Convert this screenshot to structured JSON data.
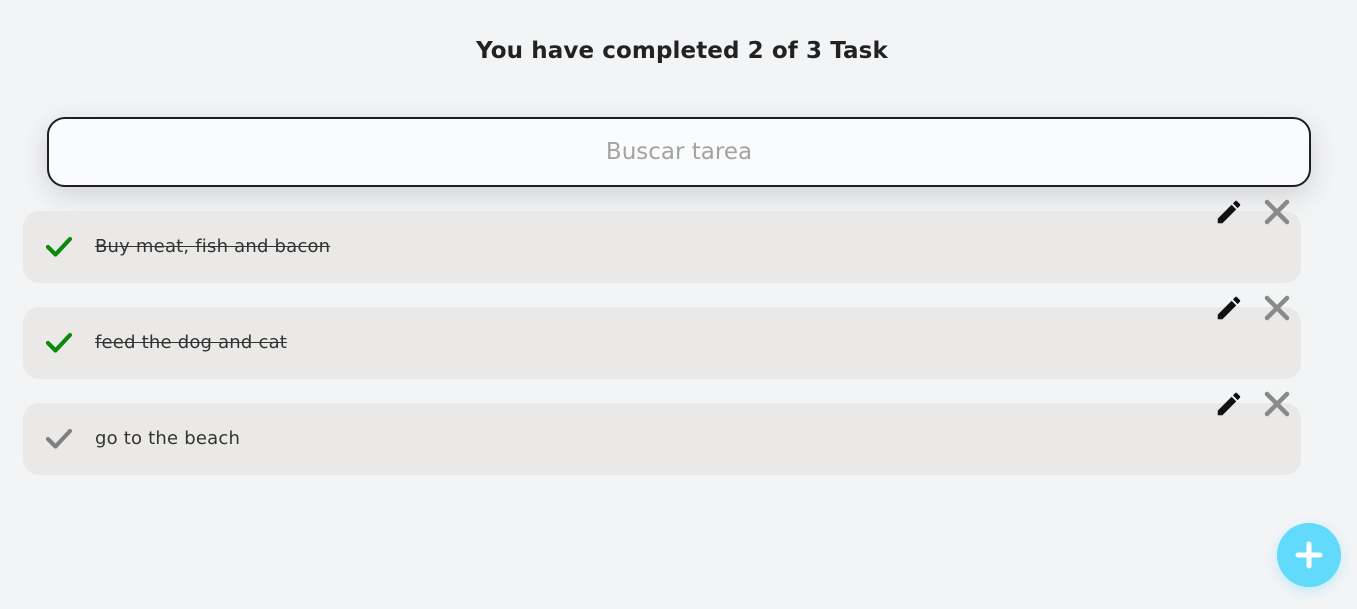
{
  "counter": {
    "prefix": "You have completed",
    "completed": "2",
    "of": "of",
    "total": "3",
    "suffix": "Task"
  },
  "search": {
    "placeholder": "Buscar tarea",
    "value": ""
  },
  "todos": [
    {
      "text": "Buy meat, fish and bacon",
      "completed": true
    },
    {
      "text": "feed the dog and cat",
      "completed": true
    },
    {
      "text": "go to the beach",
      "completed": false
    }
  ],
  "icons": {
    "check": "check-icon",
    "edit": "pencil-icon",
    "delete": "close-icon",
    "add": "plus-icon"
  },
  "colors": {
    "check_done": "#0a8a0a",
    "check_pending": "#808080",
    "delete": "#8a8a8a",
    "fab": "#61dafb",
    "item_bg": "#eae9e7"
  }
}
